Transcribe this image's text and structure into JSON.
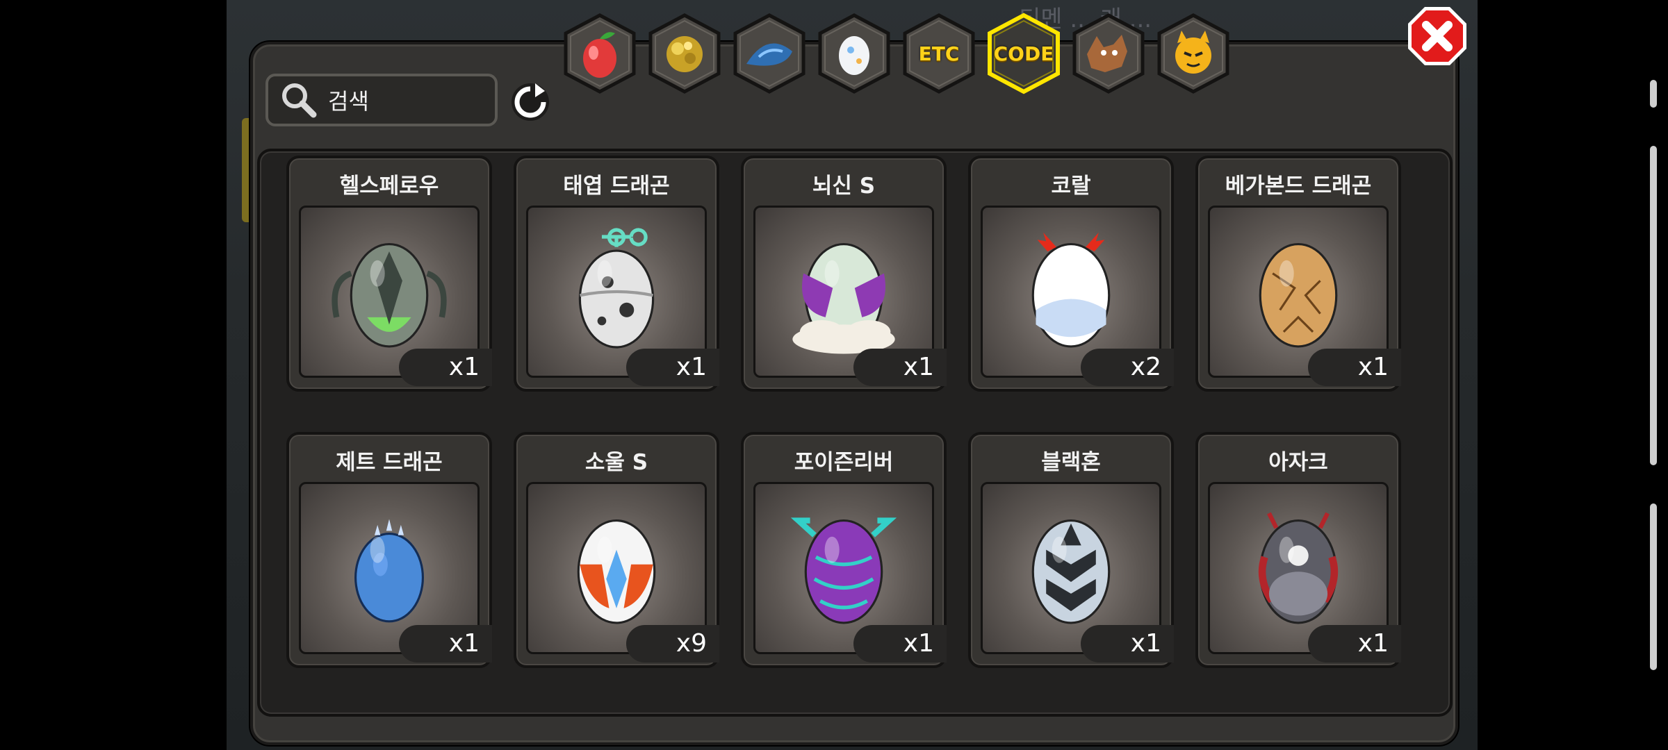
{
  "background": {
    "hint_text": "티멘 ... 캐 ..."
  },
  "search": {
    "placeholder": "검색"
  },
  "tabs": [
    {
      "id": "fruit",
      "icon": "red-fruit-icon",
      "label": ""
    },
    {
      "id": "gold",
      "icon": "gold-ore-icon",
      "label": ""
    },
    {
      "id": "scale",
      "icon": "blue-scale-icon",
      "label": ""
    },
    {
      "id": "egg",
      "icon": "egg-icon",
      "label": ""
    },
    {
      "id": "etc",
      "icon": "",
      "label": "ETC"
    },
    {
      "id": "code",
      "icon": "",
      "label": "CODE",
      "selected": true
    },
    {
      "id": "beast",
      "icon": "brown-beast-icon",
      "label": ""
    },
    {
      "id": "face",
      "icon": "yellow-face-icon",
      "label": ""
    }
  ],
  "items": [
    {
      "name": "헬스페로우",
      "qty": "x1",
      "egg": "hellsparrow",
      "colors": [
        "#7d8a7d",
        "#3b463f",
        "#7cff5a"
      ]
    },
    {
      "name": "태엽 드래곤",
      "qty": "x1",
      "egg": "clockwork",
      "colors": [
        "#e4e4e4",
        "#9a9a9a",
        "#66ddc4"
      ]
    },
    {
      "name": "뇌신 S",
      "qty": "x1",
      "egg": "thunder",
      "colors": [
        "#d8e8d8",
        "#8e3ab3",
        "#f3eee4"
      ]
    },
    {
      "name": "코랄",
      "qty": "x2",
      "egg": "coral",
      "colors": [
        "#ffffff",
        "#c9dcf5",
        "#e52b1b"
      ]
    },
    {
      "name": "베가본드 드래곤",
      "qty": "x1",
      "egg": "vagabond",
      "colors": [
        "#d7a25f",
        "#a66d2c",
        "#6b431a"
      ]
    },
    {
      "name": "제트 드래곤",
      "qty": "x1",
      "egg": "jet",
      "colors": [
        "#4a8ad8",
        "#1f4f9a",
        "#cfe2ff"
      ]
    },
    {
      "name": "소울 S",
      "qty": "x9",
      "egg": "soul",
      "colors": [
        "#f5f5f5",
        "#e8541e",
        "#5aaaf0"
      ]
    },
    {
      "name": "포이즌리버",
      "qty": "x1",
      "egg": "poison",
      "colors": [
        "#8a3ab8",
        "#4a1f7a",
        "#33d0c8"
      ]
    },
    {
      "name": "블랙혼",
      "qty": "x1",
      "egg": "blackhorn",
      "colors": [
        "#c8d4e0",
        "#2a2e33",
        "#8fa3b8"
      ]
    },
    {
      "name": "아자크",
      "qty": "x1",
      "egg": "azak",
      "colors": [
        "#5d5d66",
        "#1b1b1e",
        "#b3252a"
      ]
    }
  ],
  "colors": {
    "accent": "#ffd21a",
    "close": "#e21b1b"
  }
}
